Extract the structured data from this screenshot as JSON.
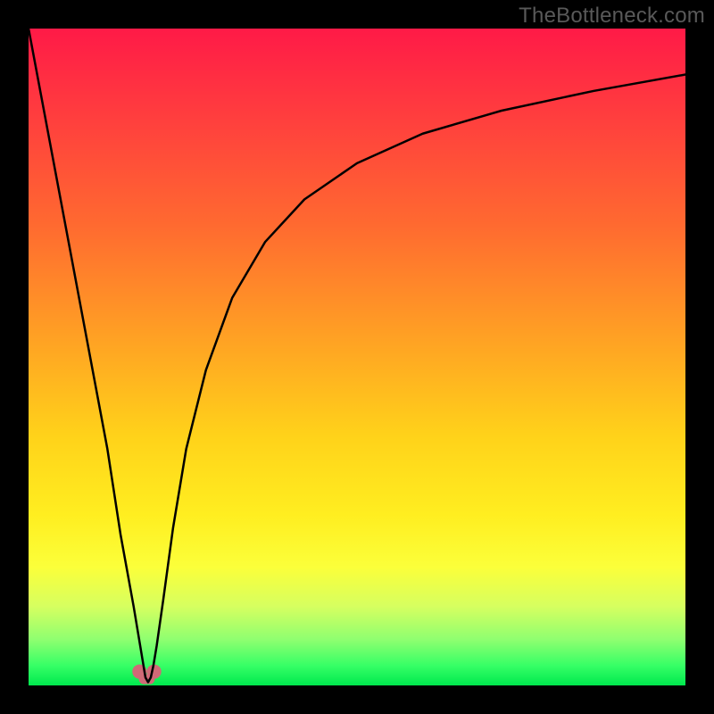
{
  "watermark": "TheBottleneck.com",
  "chart_data": {
    "type": "line",
    "title": "",
    "xlabel": "",
    "ylabel": "",
    "xlim": [
      0,
      100
    ],
    "ylim": [
      0,
      100
    ],
    "grid": false,
    "series": [
      {
        "name": "curve",
        "x": [
          0,
          3,
          6,
          9,
          12,
          14,
          16,
          17,
          17.5,
          17.8,
          18.2,
          18.6,
          19,
          19.5,
          20.5,
          22,
          24,
          27,
          31,
          36,
          42,
          50,
          60,
          72,
          86,
          100
        ],
        "y": [
          100,
          84,
          68,
          52,
          36,
          23,
          12,
          6,
          3,
          1.2,
          0.5,
          1.2,
          3,
          6,
          13,
          24,
          36,
          48,
          59,
          67.5,
          74,
          79.5,
          84,
          87.5,
          90.5,
          93
        ]
      }
    ],
    "marker": {
      "name": "pink-u-marker",
      "x_center": 18.0,
      "y_center": 1.5,
      "width": 4,
      "height": 4,
      "color": "#d06a77"
    },
    "colors": {
      "gradient_top": "#ff1a47",
      "gradient_mid": "#ffd21a",
      "gradient_bottom": "#00e84e",
      "curve_stroke": "#000000",
      "marker_fill": "#d06a77",
      "frame": "#000000"
    }
  }
}
